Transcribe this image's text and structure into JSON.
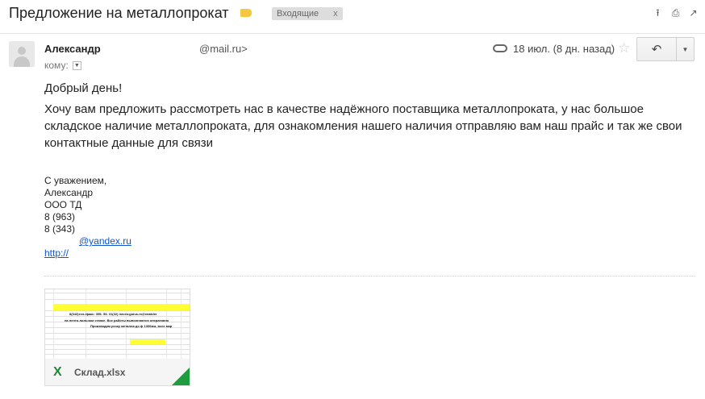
{
  "header": {
    "subject": "Предложение на металлопрокат",
    "folder_label": "Входящие",
    "folder_remove": "x",
    "icons": [
      "archive-icon",
      "print-icon",
      "new-window-icon"
    ]
  },
  "message": {
    "sender_name": "Александр",
    "sender_email": "@mail.ru>",
    "to_label": "кому:",
    "date": "18 июл. (8 дн. назад)",
    "greeting": "Добрый день!",
    "body": "Хочу вам предложить рассмотреть нас в качестве надёжного поставщика металлопроката, у нас большое складское наличие металлопроката, для ознакомления нашего наличия отправляю вам наш прайс и так же свои контактные данные для связи",
    "signature": {
      "lines": [
        "С уважением,",
        "Александр",
        "ООО ТД",
        "8 (963)",
        "8 (343)"
      ],
      "email": "@yandex.ru",
      "url": "http://"
    }
  },
  "attachment": {
    "file_name": "Склад.xlsx",
    "preview_line1": "8(343)тел./факс: 355- 55- 31(32)      почта:garus-m@rambler",
    "preview_line2": "на ленто-пильном станке. Все работы выполняются оперативно",
    "preview_line3": "Производим резку металла до ф 1300мм, всех мар"
  },
  "colors": {
    "label_tag": "#f5c842",
    "link": "#1155cc",
    "excel_green": "#1d8a3a"
  }
}
